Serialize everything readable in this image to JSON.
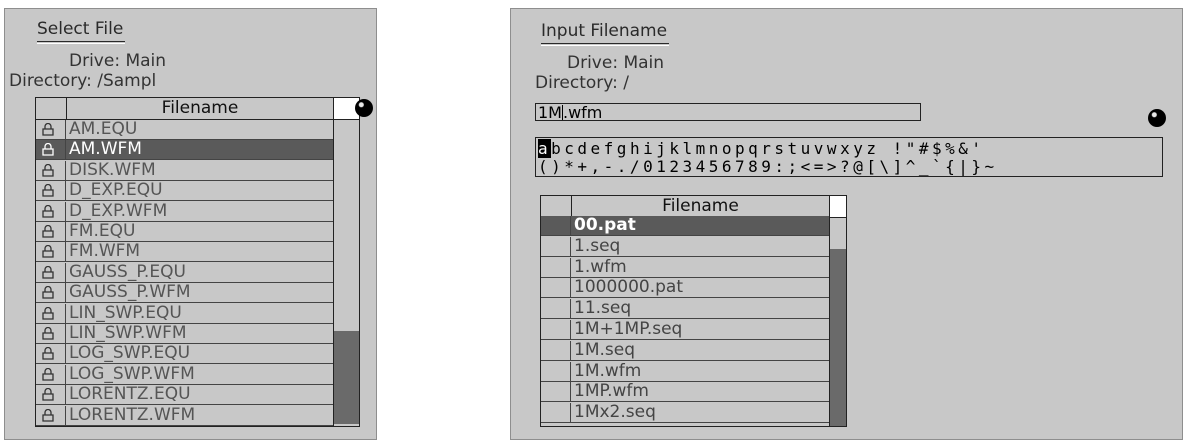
{
  "left": {
    "title": "Select File",
    "drive": "Drive: Main",
    "directory": "Directory: /Sampl",
    "column_header": "Filename",
    "files": [
      "AM.EQU",
      "AM.WFM",
      "DISK.WFM",
      "D_EXP.EQU",
      "D_EXP.WFM",
      "FM.EQU",
      "FM.WFM",
      "GAUSS_P.EQU",
      "GAUSS_P.WFM",
      "LIN_SWP.EQU",
      "LIN_SWP.WFM",
      "LOG_SWP.EQU",
      "LOG_SWP.WFM",
      "LORENTZ.EQU",
      "LORENTZ.WFM"
    ],
    "selected_index": 1,
    "scroll_position": 0.7
  },
  "right": {
    "title": "Input Filename",
    "drive": "Drive: Main",
    "directory": "Directory: /",
    "input_before_caret": "1M",
    "input_after_caret": ".wfm",
    "char_highlight": "a",
    "char_row1_rest": "bcdefghijklmnopqrstuvwxyz !\"#$%&'",
    "char_row2": "()*+,-./0123456789:;<=>?@[\\]^_`{|}~",
    "column_header": "Filename",
    "files": [
      "00.pat",
      "1.seq",
      "1.wfm",
      "1000000.pat",
      "11.seq",
      "1M+1MP.seq",
      "1M.seq",
      "1M.wfm",
      "1MP.wfm",
      "1Mx2.seq"
    ],
    "selected_index": 0,
    "scroll_position": 0.15
  },
  "icons": {
    "lock": "lock-icon",
    "knob": "knob-icon"
  }
}
